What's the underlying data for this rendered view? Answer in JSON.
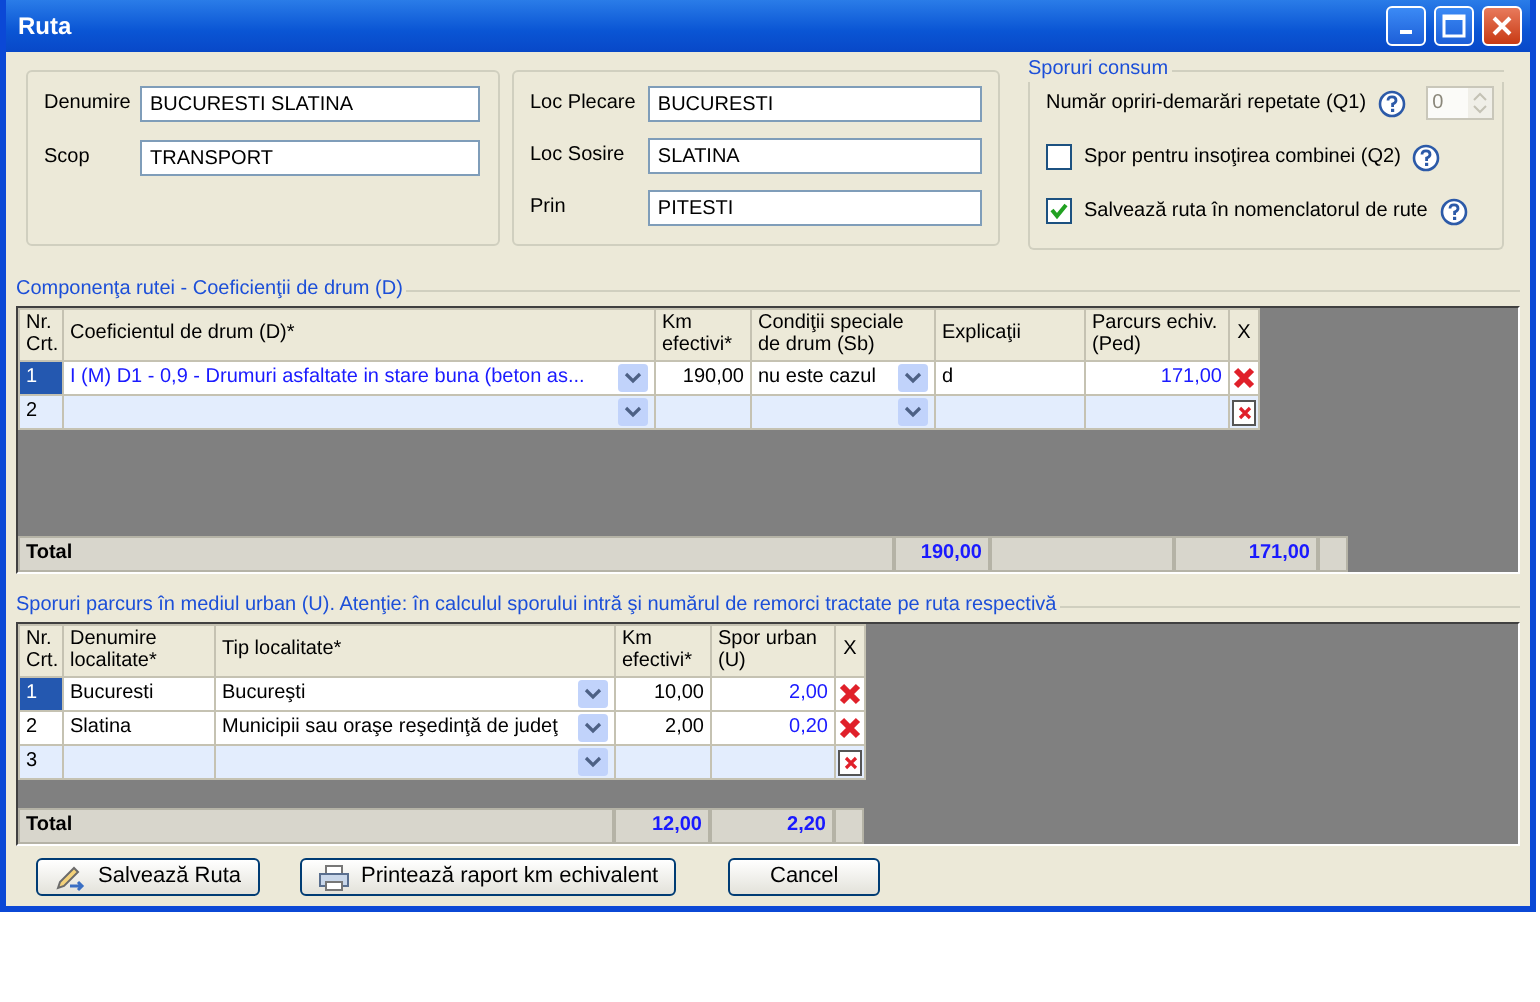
{
  "window": {
    "title": "Ruta"
  },
  "route": {
    "left": [
      {
        "label": "Denumire",
        "value": "BUCURESTI SLATINA"
      },
      {
        "label": "Scop",
        "value": "TRANSPORT"
      }
    ],
    "right": [
      {
        "label": "Loc Plecare",
        "value": "BUCURESTI"
      },
      {
        "label": "Loc Sosire",
        "value": "SLATINA"
      },
      {
        "label": "Prin",
        "value": "PITESTI"
      }
    ]
  },
  "sporuri_consum": {
    "title": "Sporuri consum",
    "items": [
      {
        "kind": "spinner",
        "label": "Număr opriri-demarări repetate (Q1)",
        "value": "0",
        "disabled": true
      },
      {
        "kind": "checkbox",
        "label": "Spor pentru insoţirea combinei (Q2)",
        "checked": false
      },
      {
        "kind": "checkbox",
        "label": "Salvează ruta în nomenclatorul de rute",
        "checked": true
      }
    ]
  },
  "road_grid": {
    "legend": "Componenţa rutei - Coeficienţii de drum (D)",
    "columns": [
      "Nr. Crt.",
      "Coeficientul de drum (D)*",
      "Km efectivi*",
      "Condiţii speciale de drum (Sb)",
      "Explicaţii",
      "Parcurs echiv. (Ped)",
      "X"
    ],
    "rows": [
      {
        "nr": "1",
        "kind": "entry",
        "selected": true,
        "coeficient": "I (M) D1 - 0,9 - Drumuri asfaltate in stare buna (beton as...",
        "km": "190,00",
        "conditii": "nu este cazul",
        "explicatii": "d",
        "parcurs": "171,00"
      },
      {
        "nr": "2",
        "kind": "new",
        "selected": false
      }
    ],
    "total": {
      "label": "Total",
      "km": "190,00",
      "parcurs": "171,00"
    }
  },
  "urban_grid": {
    "legend": "Sporuri parcurs în mediul urban (U). Atenţie: în calculul sporului intră şi numărul de remorci tractate pe ruta respectivă",
    "columns": [
      "Nr. Crt.",
      "Denumire localitate*",
      "Tip localitate*",
      "Km efectivi*",
      "Spor urban (U)",
      "X"
    ],
    "rows": [
      {
        "nr": "1",
        "kind": "entry",
        "selected": true,
        "denumire": "Bucuresti",
        "tip": "Bucureşti",
        "km": "10,00",
        "spor": "2,00"
      },
      {
        "nr": "2",
        "kind": "entry",
        "selected": false,
        "denumire": "Slatina",
        "tip": "Municipii sau oraşe reşedinţă de judeţ",
        "km": "2,00",
        "spor": "0,20"
      },
      {
        "nr": "3",
        "kind": "new",
        "selected": false
      }
    ],
    "total": {
      "label": "Total",
      "km": "12,00",
      "spor": "2,20"
    }
  },
  "buttons": [
    {
      "label": "Salvează Ruta"
    },
    {
      "label": "Printează raport km echivalent"
    },
    {
      "label": "Cancel"
    }
  ]
}
